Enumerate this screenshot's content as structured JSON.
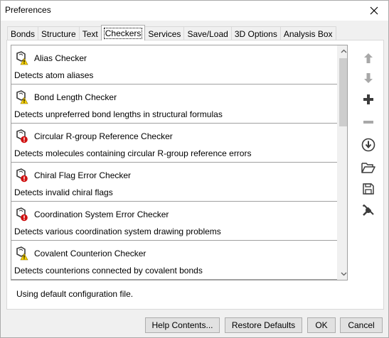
{
  "window": {
    "title": "Preferences"
  },
  "tabs": [
    {
      "label": "Bonds"
    },
    {
      "label": "Structure"
    },
    {
      "label": "Text"
    },
    {
      "label": "Checkers"
    },
    {
      "label": "Services"
    },
    {
      "label": "Save/Load"
    },
    {
      "label": "3D Options"
    },
    {
      "label": "Analysis Box"
    }
  ],
  "active_tab": "Checkers",
  "checkers": [
    {
      "name": "Alias Checker",
      "description": "Detects atom aliases",
      "severity": "warning"
    },
    {
      "name": "Bond Length Checker",
      "description": "Detects unpreferred bond lengths in structural formulas",
      "severity": "warning"
    },
    {
      "name": "Circular R-group Reference Checker",
      "description": "Detects molecules containing circular R-group reference errors",
      "severity": "error"
    },
    {
      "name": "Chiral Flag Error Checker",
      "description": "Detects invalid chiral flags",
      "severity": "error"
    },
    {
      "name": "Coordination System Error Checker",
      "description": "Detects various coordination system drawing problems",
      "severity": "error"
    },
    {
      "name": "Covalent Counterion Checker",
      "description": "Detects counterions connected by covalent bonds",
      "severity": "warning"
    },
    {
      "name": "",
      "description": "",
      "severity": "none"
    }
  ],
  "side_buttons": [
    {
      "icon": "arrow-up-icon",
      "enabled": false
    },
    {
      "icon": "arrow-down-icon",
      "enabled": false
    },
    {
      "icon": "plus-icon",
      "enabled": true
    },
    {
      "icon": "minus-icon",
      "enabled": false
    },
    {
      "icon": "download-circle-icon",
      "enabled": true
    },
    {
      "icon": "open-folder-icon",
      "enabled": true
    },
    {
      "icon": "save-icon",
      "enabled": true
    },
    {
      "icon": "tools-icon",
      "enabled": true
    }
  ],
  "status_text": "Using default configuration file.",
  "footer": {
    "help_label": "Help Contents...",
    "restore_label": "Restore Defaults",
    "ok_label": "OK",
    "cancel_label": "Cancel"
  },
  "colors": {
    "warning": "#f5d000",
    "error": "#d01010",
    "icon_gray": "#9a9a9a",
    "icon_dark": "#3c3c3c"
  }
}
